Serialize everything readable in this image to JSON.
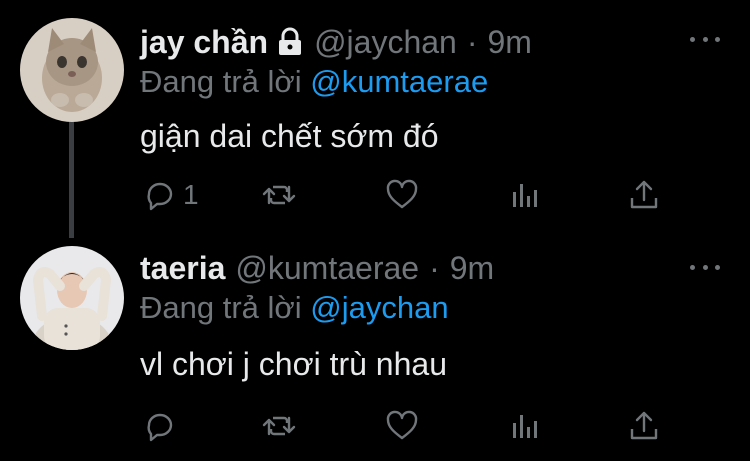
{
  "tweets": [
    {
      "display_name": "jay chần",
      "protected": true,
      "handle": "@jaychan",
      "separator": "·",
      "time": "9m",
      "replying_prefix": "Đang trả lời",
      "replying_to": "@kumtaerae",
      "text": "giận dai chết sớm đó",
      "reply_count": "1",
      "retweet_count": "",
      "like_count": ""
    },
    {
      "display_name": "taeria",
      "protected": false,
      "handle": "@kumtaerae",
      "separator": "·",
      "time": "9m",
      "replying_prefix": "Đang trả lời",
      "replying_to": "@jaychan",
      "text": "vl chơi j chơi trù nhau",
      "reply_count": "",
      "retweet_count": "",
      "like_count": ""
    }
  ],
  "icons": [
    "lock-icon",
    "more-icon",
    "reply-icon",
    "retweet-icon",
    "like-icon",
    "analytics-icon",
    "share-icon"
  ],
  "colors": {
    "background": "#000000",
    "text": "#e7e9ea",
    "muted": "#71767b",
    "link": "#1d9bf0"
  }
}
